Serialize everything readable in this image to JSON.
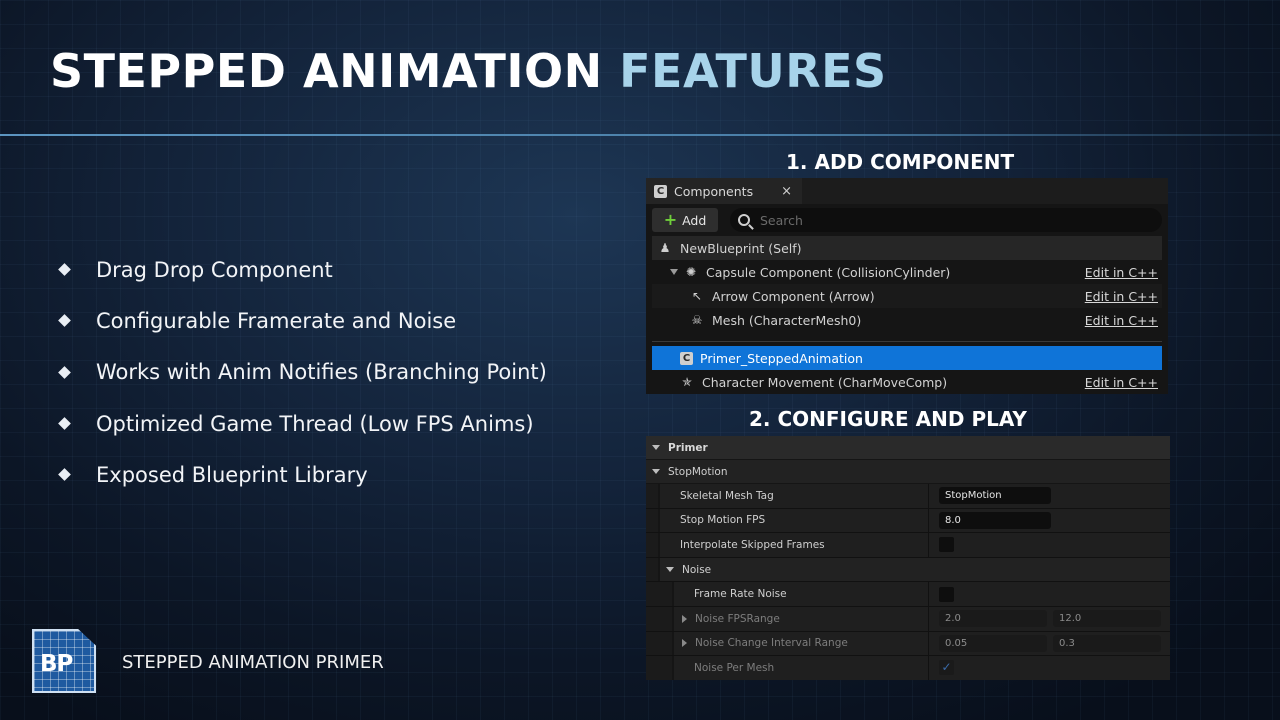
{
  "slide": {
    "title_main": "STEPPED ANIMATION",
    "title_accent": "FEATURES",
    "bullets": [
      "Drag Drop Component",
      "Configurable Framerate and Noise",
      "Works with Anim Notifies (Branching Point)",
      "Optimized Game Thread (Low FPS Anims)",
      "Exposed Blueprint Library"
    ],
    "step1": "1.  ADD COMPONENT",
    "step2": "2. CONFIGURE AND PLAY",
    "footer_logo": "BP",
    "footer_text": "STEPPED ANIMATION PRIMER"
  },
  "components_panel": {
    "tab_label": "Components",
    "tab_icon": "c-icon",
    "close_glyph": "×",
    "add_label": "Add",
    "search_placeholder": "Search",
    "rows": [
      {
        "label": "NewBlueprint (Self)",
        "icon": "pawn-icon",
        "edit": ""
      },
      {
        "label": "Capsule Component (CollisionCylinder)",
        "icon": "capsule-icon",
        "edit": "Edit in C++"
      },
      {
        "label": "Arrow Component (Arrow)",
        "icon": "arrow-icon",
        "edit": "Edit in C++"
      },
      {
        "label": "Mesh (CharacterMesh0)",
        "icon": "skeleton-icon",
        "edit": "Edit in C++"
      },
      {
        "label": "Primer_SteppedAnimation",
        "icon": "c-icon",
        "edit": ""
      },
      {
        "label": "Character Movement (CharMoveComp)",
        "icon": "movement-icon",
        "edit": "Edit in C++"
      }
    ],
    "selected_color": "#0f74d8"
  },
  "details_panel": {
    "category": "Primer",
    "subcategory": "StopMotion",
    "skeletal_mesh_tag_label": "Skeletal Mesh Tag",
    "skeletal_mesh_tag_value": "StopMotion",
    "stop_motion_fps_label": "Stop Motion FPS",
    "stop_motion_fps_value": "8.0",
    "interpolate_label": "Interpolate Skipped Frames",
    "noise_group": "Noise",
    "frame_rate_noise_label": "Frame Rate Noise",
    "noise_fps_range_label": "Noise FPSRange",
    "noise_fps_range_min": "2.0",
    "noise_fps_range_max": "12.0",
    "noise_interval_label": "Noise Change Interval Range",
    "noise_interval_min": "0.05",
    "noise_interval_max": "0.3",
    "noise_per_mesh_label": "Noise Per Mesh",
    "check_glyph": "✓"
  }
}
